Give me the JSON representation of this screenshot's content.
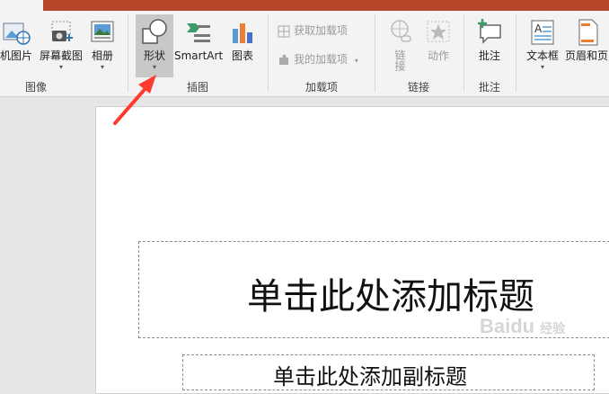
{
  "ribbon": {
    "groups": {
      "images": {
        "label": "图像",
        "buttons": {
          "online_pictures": "机图片",
          "screenshot": "屏幕截图",
          "album": "相册"
        }
      },
      "illustrations": {
        "label": "插图",
        "buttons": {
          "shapes": "形状",
          "smartart": "SmartArt",
          "chart": "图表"
        }
      },
      "addins": {
        "label": "加载项",
        "get_addins": "获取加载项",
        "my_addins": "我的加载项"
      },
      "links": {
        "label": "链接",
        "link": "链接",
        "action": "动作"
      },
      "comments": {
        "label": "批注",
        "comment": "批注"
      },
      "text": {
        "textbox": "文本框",
        "header_footer": "页眉和页"
      }
    }
  },
  "slide": {
    "title_placeholder": "单击此处添加标题",
    "subtitle_placeholder": "单击此处添加副标题"
  },
  "watermark": {
    "brand": "Baidu",
    "suffix": "经验"
  },
  "colors": {
    "accent": "#b7472a",
    "arrow": "#ff3b2f"
  }
}
